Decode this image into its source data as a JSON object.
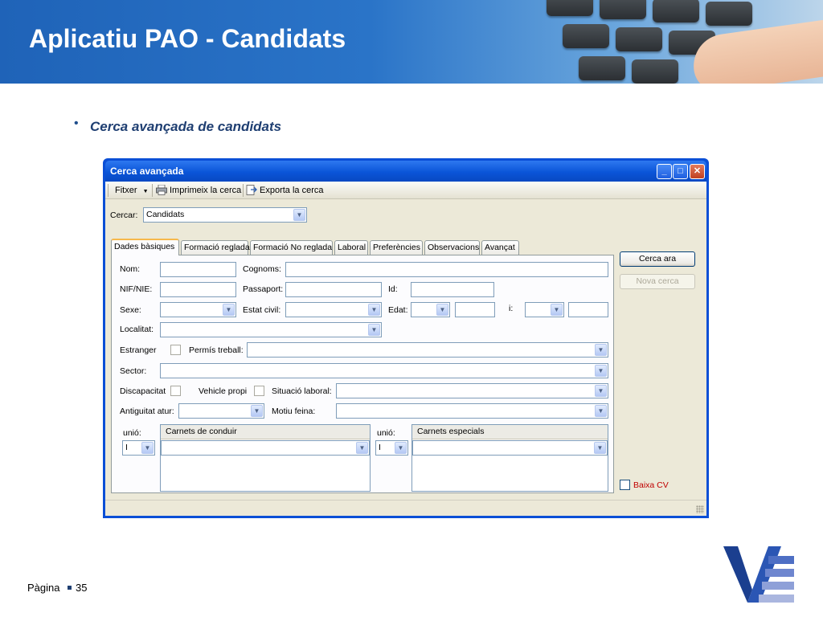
{
  "slide": {
    "title": "Aplicatiu PAO - Candidats",
    "bullet": "Cerca avançada de candidats",
    "page_label": "Pàgina",
    "page_number": "35"
  },
  "window": {
    "title": "Cerca avançada",
    "controls": [
      "_",
      "□",
      "✕"
    ]
  },
  "toolbar": {
    "file_menu": "Fitxer",
    "print": "Imprimeix la cerca",
    "export": "Exporta la cerca"
  },
  "search": {
    "label": "Cercar:",
    "value": "Candidats"
  },
  "tabs": [
    "Dades bàsiques",
    "Formació reglada",
    "Formació No reglada",
    "Laboral",
    "Preferències",
    "Observacions",
    "Avançat"
  ],
  "fields": {
    "nom": "Nom:",
    "cognoms": "Cognoms:",
    "nif": "NIF/NIE:",
    "passaport": "Passaport:",
    "id": "Id:",
    "sexe": "Sexe:",
    "estat_civil": "Estat civil:",
    "edat": "Edat:",
    "i": "i:",
    "localitat": "Localitat:",
    "estranger": "Estranger",
    "permis_treball": "Permís treball:",
    "sector": "Sector:",
    "discapacitat": "Discapacitat",
    "vehicle_propi": "Vehicle propi",
    "situacio_laboral": "Situació laboral:",
    "antiguitat_atur": "Antiguitat atur:",
    "motiu_feina": "Motiu feina:",
    "unio_1": "unió:",
    "unio_1_value": "I",
    "carnets_conduir": "Carnets de conduir",
    "unio_2": "unió:",
    "unio_2_value": "I",
    "carnets_especials": "Carnets especials"
  },
  "buttons": {
    "search": "Cerca ara",
    "new_search": "Nova cerca",
    "baixa_cv": "Baixa CV"
  },
  "colors": {
    "header_blue": "#1f63b8",
    "xp_titlebar": "#0a55d8",
    "baixa_cv_red": "#c00000",
    "logo_blue": "#1b3f8f"
  }
}
